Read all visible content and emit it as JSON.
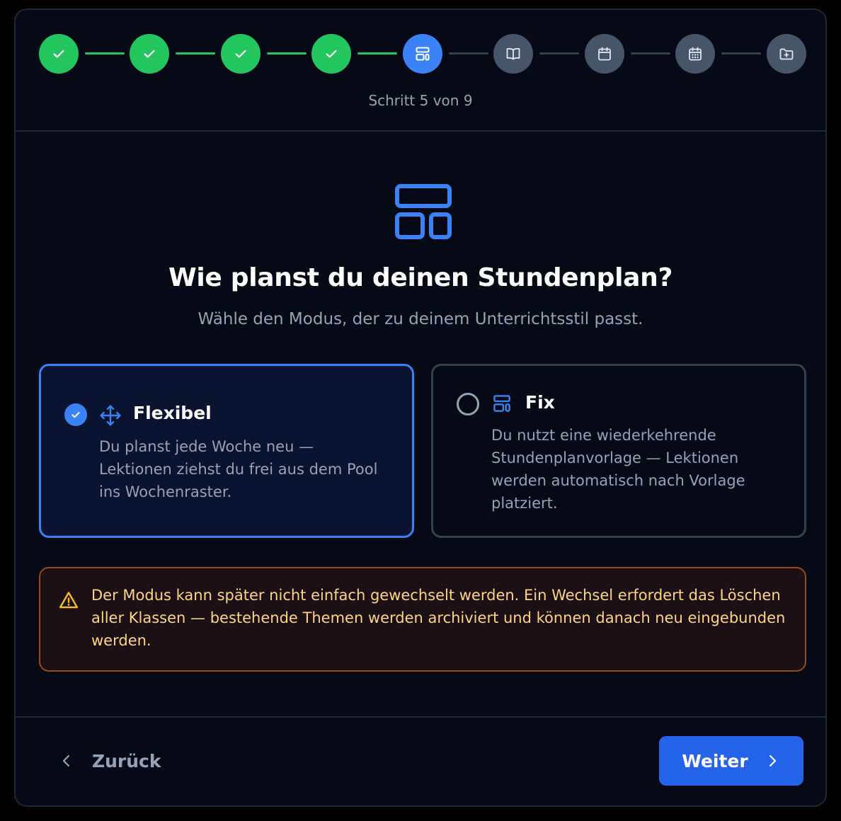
{
  "stepper": {
    "counter": "Schritt 5 von 9",
    "steps": [
      {
        "state": "done",
        "icon": "check-icon"
      },
      {
        "state": "done",
        "icon": "check-icon"
      },
      {
        "state": "done",
        "icon": "check-icon"
      },
      {
        "state": "done",
        "icon": "check-icon"
      },
      {
        "state": "active",
        "icon": "layout-icon"
      },
      {
        "state": "todo",
        "icon": "book-open-icon"
      },
      {
        "state": "todo",
        "icon": "calendar-icon"
      },
      {
        "state": "todo",
        "icon": "calendar-days-icon"
      },
      {
        "state": "todo",
        "icon": "folder-plus-icon"
      }
    ]
  },
  "header": {
    "title": "Wie planst du deinen Stundenplan?",
    "subtitle": "Wähle den Modus, der zu deinem Unterrichtsstil passt."
  },
  "options": [
    {
      "title": "Flexibel",
      "description": "Du planst jede Woche neu — Lektionen ziehst du frei aus dem Pool ins Wochenraster.",
      "selected": true,
      "icon": "move-icon"
    },
    {
      "title": "Fix",
      "description": "Du nutzt eine wiederkehrende Stundenplanvorlage — Lektionen werden automatisch nach Vorlage platziert.",
      "selected": false,
      "icon": "layout-icon"
    }
  ],
  "warning": {
    "text": "Der Modus kann später nicht einfach gewechselt werden. Ein Wechsel erfordert das Löschen aller Klassen — bestehende Themen werden archiviert und können danach neu eingebunden werden."
  },
  "footer": {
    "back_label": "Zurück",
    "next_label": "Weiter"
  },
  "colors": {
    "done": "#22c55e",
    "active": "#3b82f6",
    "todo": "#475569",
    "warning_text": "#fcd581",
    "warning_border": "#9a4a14",
    "primary_button": "#2563eb"
  }
}
